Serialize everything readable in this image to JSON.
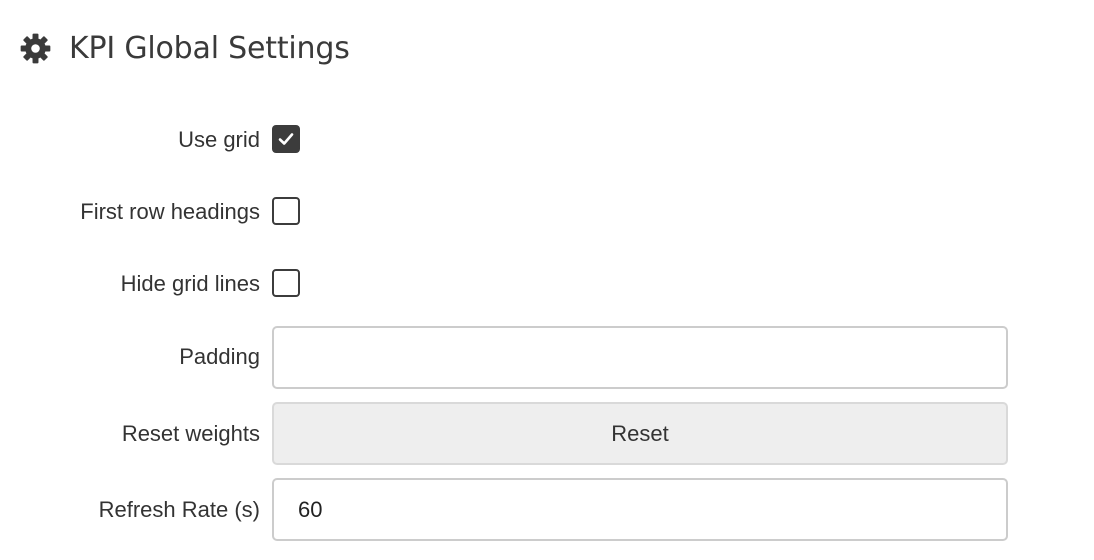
{
  "header": {
    "icon": "gear-icon",
    "title": "KPI Global Settings"
  },
  "form": {
    "use_grid": {
      "label": "Use grid",
      "checked": true
    },
    "first_row_headings": {
      "label": "First row headings",
      "checked": false
    },
    "hide_grid_lines": {
      "label": "Hide grid lines",
      "checked": false
    },
    "padding": {
      "label": "Padding",
      "value": ""
    },
    "reset_weights": {
      "label": "Reset weights",
      "button_label": "Reset"
    },
    "refresh_rate": {
      "label": "Refresh Rate (s)",
      "value": "60"
    }
  },
  "colors": {
    "text": "#333333",
    "checkbox_border": "#3c3c3c",
    "input_border": "#cccccc",
    "button_bg": "#eeeeee"
  }
}
